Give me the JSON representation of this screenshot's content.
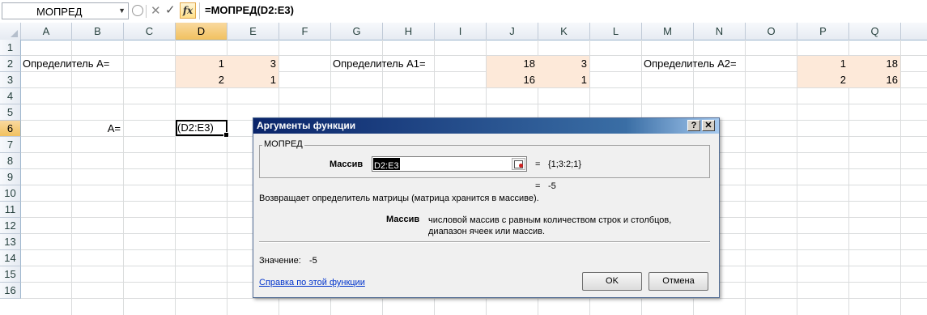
{
  "formula_bar": {
    "name_box": "МОПРЕД",
    "formula": "=МОПРЕД(D2:E3)",
    "fx_label": "fx"
  },
  "columns": [
    "A",
    "B",
    "C",
    "D",
    "E",
    "F",
    "G",
    "H",
    "I",
    "J",
    "K",
    "L",
    "M",
    "N",
    "O",
    "P",
    "Q"
  ],
  "selected_column": "D",
  "rows": [
    "1",
    "2",
    "3",
    "4",
    "5",
    "6",
    "7",
    "8",
    "9",
    "10",
    "11",
    "12",
    "13",
    "14",
    "15",
    "16"
  ],
  "selected_row": "6",
  "cells": {
    "A2": "Определитель  А=",
    "D2": "1",
    "E2": "3",
    "D3": "2",
    "E3": "1",
    "G2": "Определитель А1=",
    "J2": "18",
    "K2": "3",
    "J3": "16",
    "K3": "1",
    "M2": "Определитель А2=",
    "P2": "1",
    "Q2": "18",
    "P3": "2",
    "Q3": "16",
    "B6": "А=",
    "D6": "(D2:E3)"
  },
  "colors": {
    "highlight_fill": "#fde9d9",
    "selected_header": "#f1c15f",
    "dialog_title": "#0a246a"
  },
  "dialog": {
    "title": "Аргументы функции",
    "help_btn": "?",
    "close_btn": "✕",
    "group_label": "МОПРЕД",
    "arg_label": "Массив",
    "arg_value": "D2:E3",
    "arg_eq": "=",
    "arg_result": "{1;3:2;1}",
    "result_eq": "=",
    "result_value": "-5",
    "description": "Возвращает определитель матрицы (матрица хранится в массиве).",
    "arg_name": "Массив",
    "arg_description": "числовой массив с равным количеством строк и столбцов, диапазон ячеек или массив.",
    "value_label": "Значение:",
    "value": "-5",
    "help_link": "Справка по этой функции",
    "ok": "OK",
    "cancel": "Отмена"
  }
}
